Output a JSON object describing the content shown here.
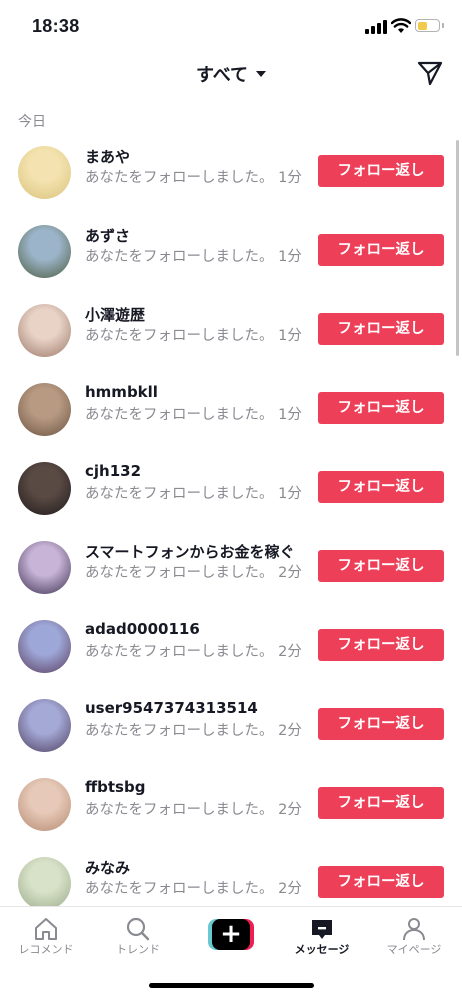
{
  "status_bar": {
    "time": "18:38"
  },
  "header": {
    "title": "すべて"
  },
  "section": {
    "label": "今日"
  },
  "notifications": [
    {
      "name": "まあや",
      "text": "あなたをフォローしました。",
      "time": "1分",
      "button": "フォロー返し",
      "avatar_colors": [
        "#f4e3b0",
        "#d9c27a"
      ]
    },
    {
      "name": "あずさ",
      "text": "あなたをフォローしました。",
      "time": "1分",
      "button": "フォロー返し",
      "avatar_colors": [
        "#9cb4c9",
        "#4b5d3f"
      ]
    },
    {
      "name": "小澤遊歴",
      "text": "あなたをフォローしました。",
      "time": "1分",
      "button": "フォロー返し",
      "avatar_colors": [
        "#e8d3c6",
        "#9b7868"
      ]
    },
    {
      "name": "hmmbkll",
      "text": "あなたをフォローしました。",
      "time": "1分",
      "button": "フォロー返し",
      "avatar_colors": [
        "#b89a82",
        "#6b5443"
      ]
    },
    {
      "name": "cjh132",
      "text": "あなたをフォローしました。",
      "time": "1分",
      "button": "フォロー返し",
      "avatar_colors": [
        "#5a4a44",
        "#1e1a1a"
      ]
    },
    {
      "name": "スマートフォンからお金を稼ぐ",
      "text": "あなたをフォローしました。",
      "time": "2分",
      "button": "フォロー返し",
      "avatar_colors": [
        "#c7b4d6",
        "#3c2f52"
      ]
    },
    {
      "name": "adad0000116",
      "text": "あなたをフォローしました。",
      "time": "2分",
      "button": "フォロー返し",
      "avatar_colors": [
        "#9ea8d8",
        "#5a3c5e"
      ]
    },
    {
      "name": "user9547374313514",
      "text": "あなたをフォローしました。",
      "time": "2分",
      "button": "フォロー返し",
      "avatar_colors": [
        "#a4a9d6",
        "#4f3f5f"
      ]
    },
    {
      "name": "ffbtsbg",
      "text": "あなたをフォローしました。",
      "time": "2分",
      "button": "フォロー返し",
      "avatar_colors": [
        "#e6c9b8",
        "#b58a71"
      ]
    },
    {
      "name": "みなみ",
      "text": "あなたをフォローしました。",
      "time": "2分",
      "button": "フォロー返し",
      "avatar_colors": [
        "#d8e2c8",
        "#9aa98a"
      ]
    }
  ],
  "tabbar": {
    "home": "レコメンド",
    "discover": "トレンド",
    "inbox": "メッセージ",
    "profile": "マイページ"
  },
  "colors": {
    "accent": "#ee3f58",
    "muted": "#8a8b91"
  }
}
